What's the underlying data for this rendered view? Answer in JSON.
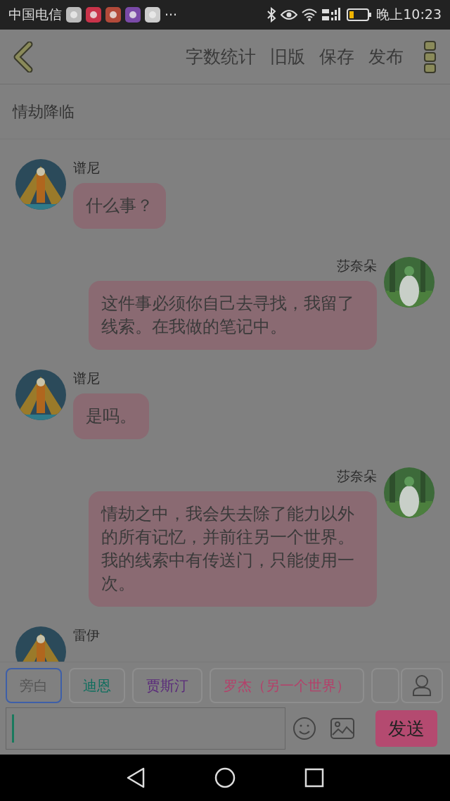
{
  "status_bar": {
    "carrier": "中国电信",
    "more": "···",
    "time": "晚上10:23"
  },
  "toolbar": {
    "actions": [
      "字数统计",
      "旧版",
      "保存",
      "发布"
    ]
  },
  "chapter_title": "情劫降临",
  "messages": [
    {
      "kind": "incoming",
      "sender": "谱尼",
      "text": "什么事？"
    },
    {
      "kind": "outgoing",
      "sender": "莎奈朵",
      "text": "这件事必须你自己去寻找，我留了线索。在我做的笔记中。"
    },
    {
      "kind": "incoming",
      "sender": "谱尼",
      "text": "是吗。"
    },
    {
      "kind": "outgoing",
      "sender": "莎奈朵",
      "text": "情劫之中，我会失去除了能力以外的所有记忆，并前往另一个世界。我的线索中有传送门，只能使用一次。"
    }
  ],
  "partial_sender": "雷伊",
  "roles": [
    {
      "label": "旁白",
      "selected": true,
      "color": "#555555"
    },
    {
      "label": "迪恩",
      "selected": false,
      "color": "#0e6e5e"
    },
    {
      "label": "贾斯汀",
      "selected": false,
      "color": "#5a2a7a"
    },
    {
      "label": "罗杰（另一个世界）",
      "selected": false,
      "color": "#b4406a"
    }
  ],
  "send_button": "发送"
}
